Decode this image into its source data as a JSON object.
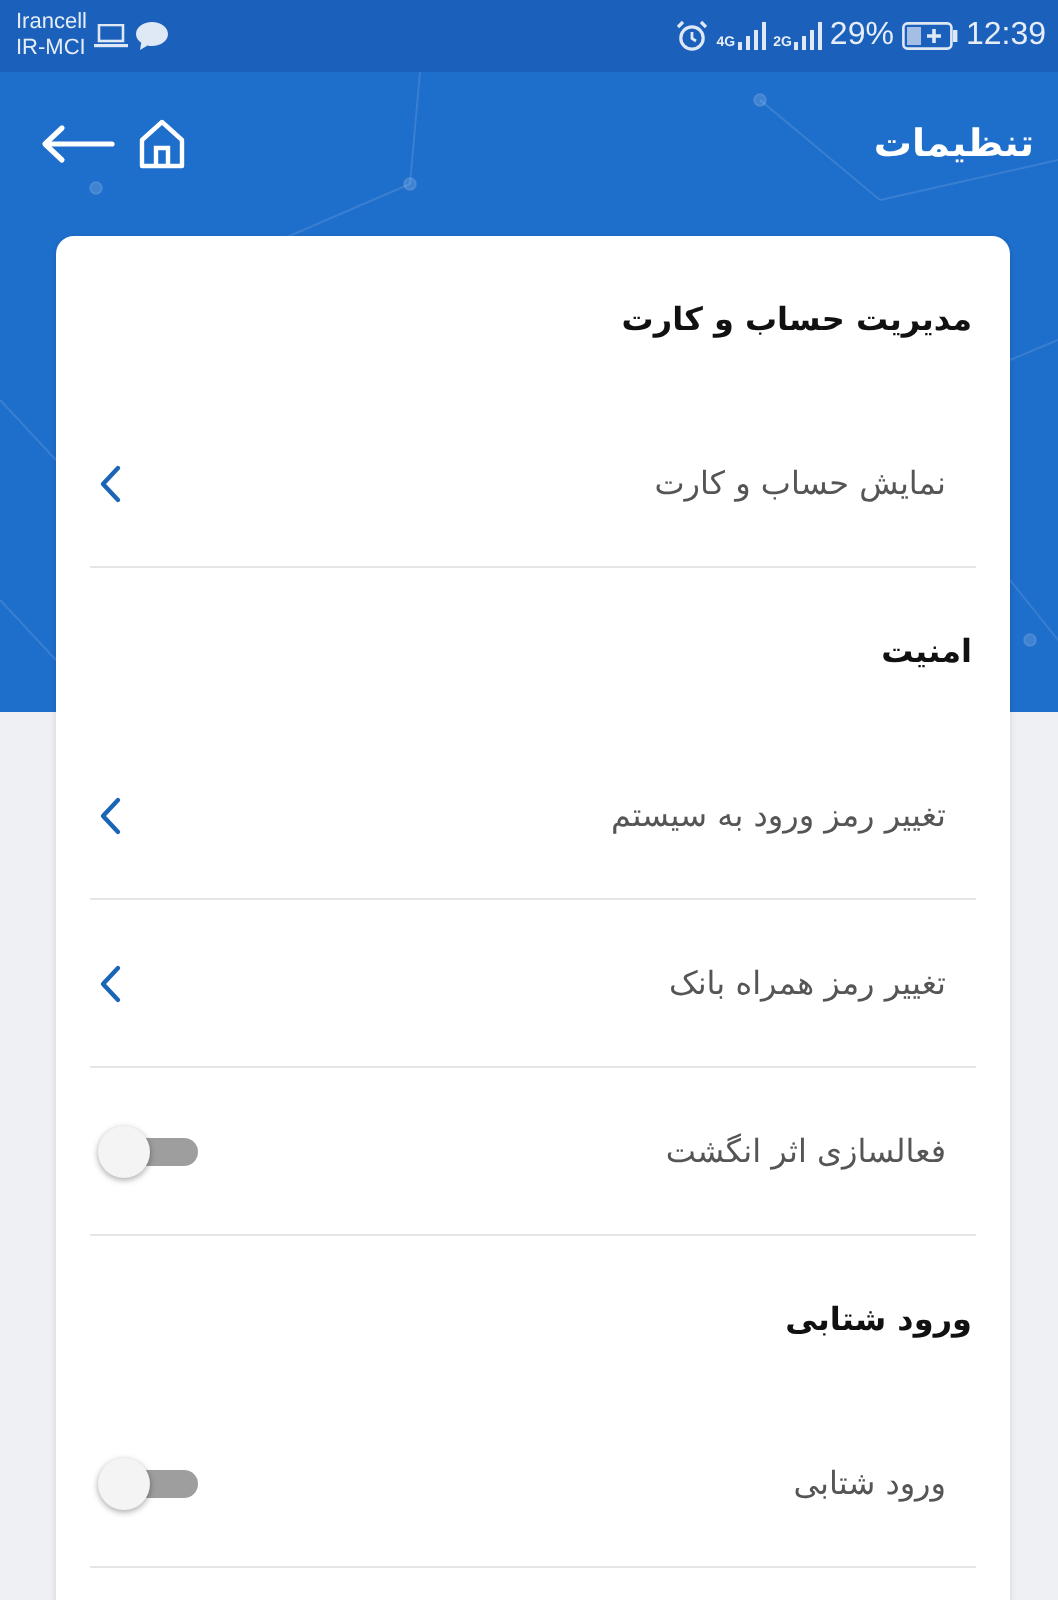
{
  "status_bar": {
    "carrier_1": "Irancell",
    "carrier_2": "IR-MCI",
    "network_1": "4G",
    "network_2": "2G",
    "battery": "29%",
    "time": "12:39"
  },
  "header": {
    "title": "تنظیمات"
  },
  "sections": [
    {
      "title": "مدیریت حساب و کارت",
      "items": [
        {
          "kind": "link",
          "label": "نمایش حساب و کارت"
        }
      ]
    },
    {
      "title": "امنیت",
      "items": [
        {
          "kind": "link",
          "label": "تغییر رمز ورود به سیستم"
        },
        {
          "kind": "link",
          "label": "تغییر رمز همراه بانک"
        },
        {
          "kind": "toggle",
          "label": "فعالسازی اثر انگشت",
          "on": false
        }
      ]
    },
    {
      "title": "ورود شتابی",
      "items": [
        {
          "kind": "toggle",
          "label": "ورود شتابی",
          "on": false
        }
      ]
    }
  ]
}
